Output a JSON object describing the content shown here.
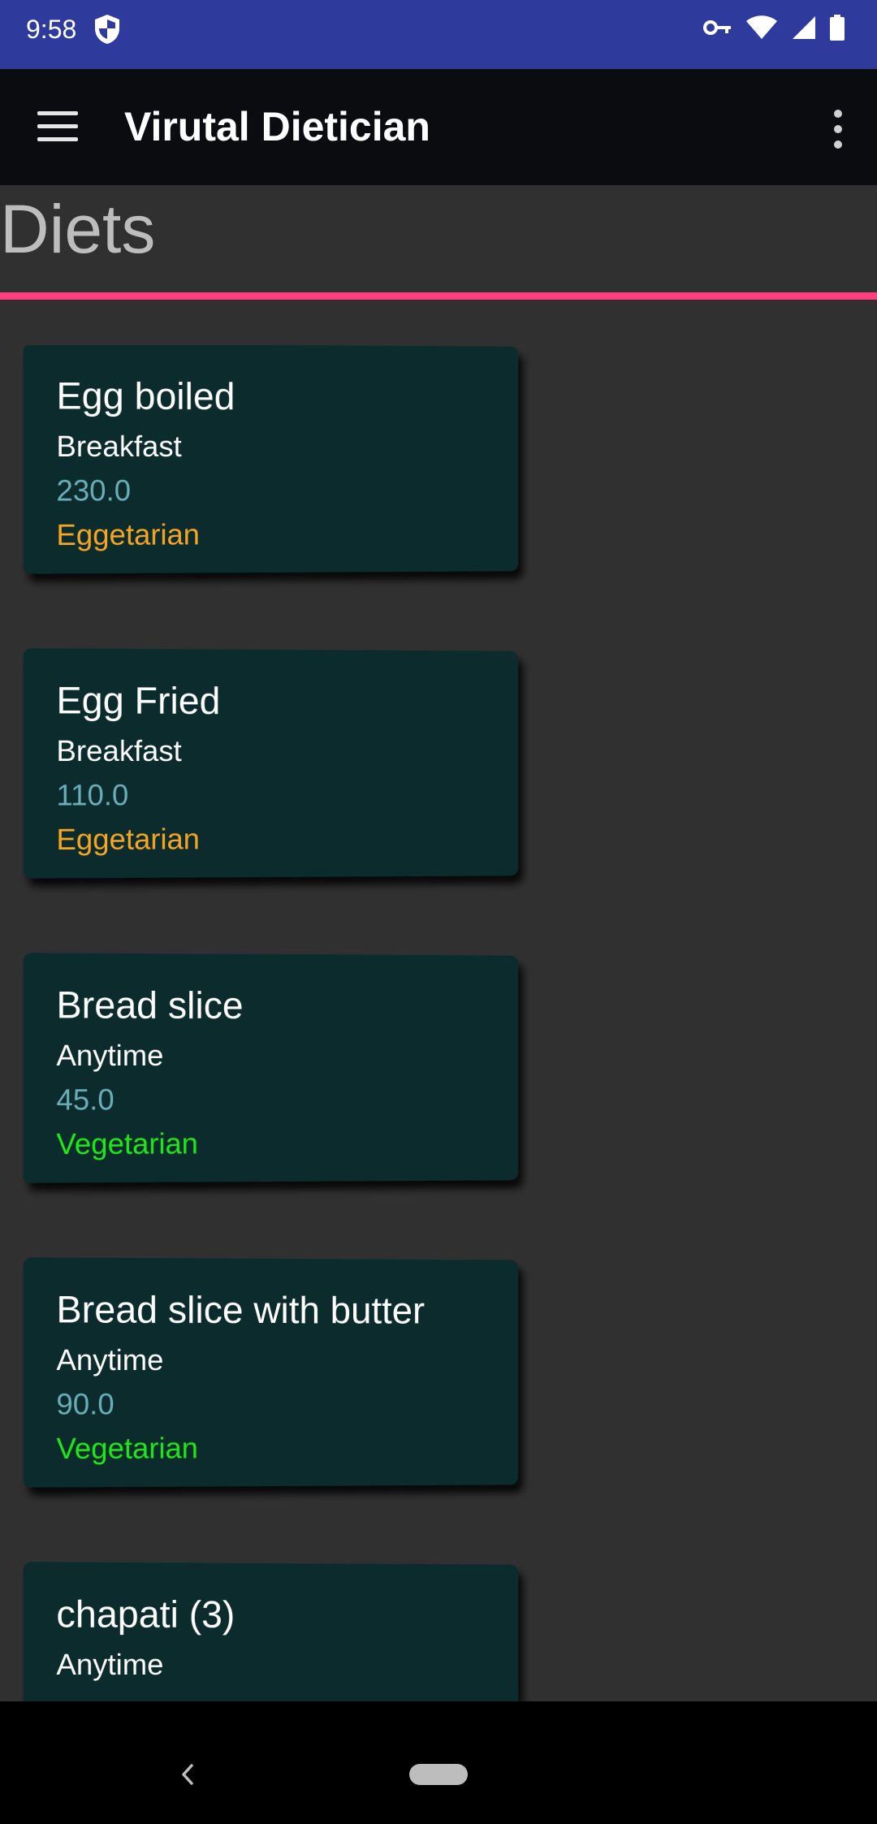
{
  "status_bar": {
    "time": "9:58",
    "icons": [
      "shield-icon",
      "vpn-key-icon",
      "wifi-icon",
      "cell-signal-icon",
      "battery-icon"
    ]
  },
  "app_bar": {
    "title": "Virutal Dietician",
    "menu_icon": "hamburger-menu-icon",
    "overflow_icon": "more-vert-icon"
  },
  "page": {
    "title": "Diets",
    "accent_color": "#ff3d7f"
  },
  "colors": {
    "eggetarian": "#f5a623",
    "vegetarian": "#1ee81a"
  },
  "diets": [
    {
      "name": "Egg boiled",
      "meal": "Breakfast",
      "calories": "230.0",
      "type": "Eggetarian"
    },
    {
      "name": "Egg Fried",
      "meal": "Breakfast",
      "calories": "110.0",
      "type": "Eggetarian"
    },
    {
      "name": "Bread slice",
      "meal": "Anytime",
      "calories": "45.0",
      "type": "Vegetarian"
    },
    {
      "name": "Bread slice with butter",
      "meal": "Anytime",
      "calories": "90.0",
      "type": "Vegetarian"
    },
    {
      "name": "chapati (3)",
      "meal": "Anytime",
      "calories": "",
      "type": ""
    }
  ]
}
